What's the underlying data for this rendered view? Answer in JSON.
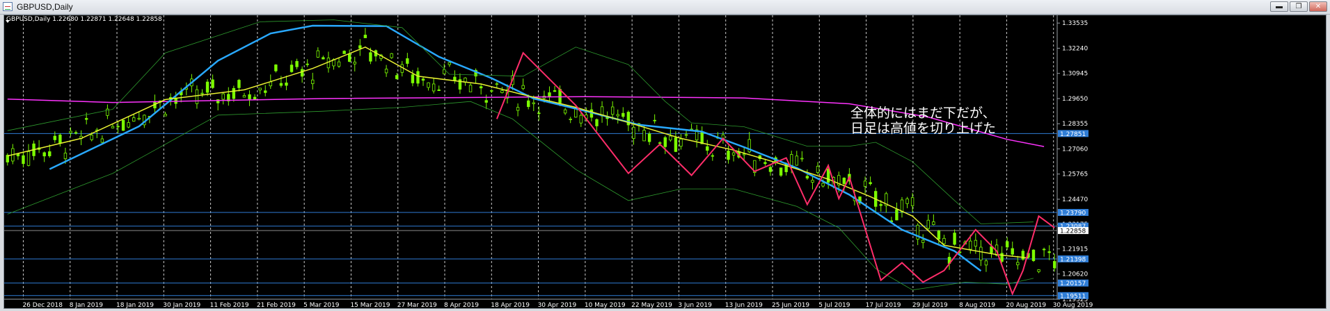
{
  "window": {
    "title": "GBPUSD,Daily",
    "buttons": [
      {
        "name": "minimize",
        "symbol": "▬"
      },
      {
        "name": "restore",
        "symbol": "❐"
      },
      {
        "name": "close",
        "symbol": "✕"
      }
    ]
  },
  "chart": {
    "symbol_header": "GBPUSD,Daily  1.22680 1.22871 1.22648 1.22858",
    "annotation_lines": [
      "全体的にはまだ下だが、",
      "日足は高値を切り上げた"
    ],
    "colors": {
      "background": "#000000",
      "candle": "#7cfc00",
      "ma_slow": "#ff33ff",
      "ma_mid": "#29a9ff",
      "ma_fast": "#e8f032",
      "bands": "#2e9b2e",
      "zigzag": "#ff2d6a",
      "hline": "#2f7dd6",
      "grid": "#ffffff"
    }
  },
  "chart_data": {
    "type": "candlestick",
    "symbol": "GBPUSD",
    "timeframe": "Daily",
    "ohlc_last": {
      "open": 1.2268,
      "high": 1.22871,
      "low": 1.22648,
      "close": 1.22858
    },
    "ylim": [
      1.19325,
      1.3365
    ],
    "y_ticks": [
      "1.33535",
      "1.32240",
      "1.30945",
      "1.29650",
      "1.28355",
      "1.27060",
      "1.25765",
      "1.24470",
      "1.23175",
      "1.21915",
      "1.20620",
      "1.19325"
    ],
    "x_ticks": [
      "26 Dec 2018",
      "8 Jan 2019",
      "18 Jan 2019",
      "30 Jan 2019",
      "11 Feb 2019",
      "21 Feb 2019",
      "5 Mar 2019",
      "15 Mar 2019",
      "27 Mar 2019",
      "8 Apr 2019",
      "18 Apr 2019",
      "30 Apr 2019",
      "10 May 2019",
      "22 May 2019",
      "3 Jun 2019",
      "13 Jun 2019",
      "25 Jun 2019",
      "5 Jul 2019",
      "17 Jul 2019",
      "29 Jul 2019",
      "8 Aug 2019",
      "20 Aug 2019",
      "30 Aug 2019"
    ],
    "price_lines": [
      {
        "label": "1.27851",
        "value": 1.27851
      },
      {
        "label": "1.23790",
        "value": 1.2379
      },
      {
        "label": "1.23087",
        "value": 1.23087
      },
      {
        "label": "1.22858",
        "value": 1.22858
      },
      {
        "label": "1.21398",
        "value": 1.21398
      },
      {
        "label": "1.20157",
        "value": 1.20157
      },
      {
        "label": "1.19511",
        "value": 1.19511
      }
    ],
    "series": [
      {
        "type": "line",
        "color_key": "ma_slow",
        "points": [
          [
            0,
            1.2962
          ],
          [
            20,
            1.2945
          ],
          [
            60,
            1.2965
          ],
          [
            110,
            1.2975
          ],
          [
            140,
            1.2968
          ],
          [
            160,
            1.2938
          ],
          [
            175,
            1.287
          ],
          [
            190,
            1.2755
          ],
          [
            197,
            1.2718
          ]
        ]
      },
      {
        "type": "line",
        "color_key": "ma_mid",
        "points": [
          [
            8,
            1.2602
          ],
          [
            25,
            1.2822
          ],
          [
            40,
            1.316
          ],
          [
            50,
            1.33
          ],
          [
            58,
            1.334
          ],
          [
            72,
            1.3338
          ],
          [
            82,
            1.318
          ],
          [
            92,
            1.307
          ],
          [
            100,
            1.2965
          ],
          [
            110,
            1.29
          ],
          [
            120,
            1.283
          ],
          [
            132,
            1.2795
          ],
          [
            140,
            1.2715
          ],
          [
            150,
            1.2608
          ],
          [
            160,
            1.247
          ],
          [
            170,
            1.229
          ],
          [
            180,
            1.218
          ],
          [
            185,
            1.2078
          ]
        ]
      },
      {
        "type": "line",
        "color_key": "ma_fast",
        "points": [
          [
            0,
            1.267
          ],
          [
            14,
            1.276
          ],
          [
            30,
            1.296
          ],
          [
            45,
            1.301
          ],
          [
            58,
            1.312
          ],
          [
            68,
            1.323
          ],
          [
            78,
            1.308
          ],
          [
            90,
            1.304
          ],
          [
            98,
            1.2985
          ],
          [
            108,
            1.292
          ],
          [
            117,
            1.285
          ],
          [
            128,
            1.276
          ],
          [
            138,
            1.27
          ],
          [
            148,
            1.262
          ],
          [
            156,
            1.255
          ],
          [
            164,
            1.246
          ],
          [
            172,
            1.236
          ],
          [
            178,
            1.221
          ],
          [
            188,
            1.2162
          ],
          [
            194,
            1.2145
          ]
        ]
      },
      {
        "type": "line",
        "color_key": "bands",
        "points": [
          [
            0,
            1.28
          ],
          [
            20,
            1.291
          ],
          [
            30,
            1.32
          ],
          [
            48,
            1.336
          ],
          [
            62,
            1.337
          ],
          [
            75,
            1.333
          ],
          [
            84,
            1.309
          ],
          [
            98,
            1.308
          ],
          [
            108,
            1.323
          ],
          [
            118,
            1.314
          ],
          [
            125,
            1.295
          ],
          [
            130,
            1.284
          ],
          [
            140,
            1.282
          ],
          [
            152,
            1.272
          ],
          [
            160,
            1.272
          ],
          [
            165,
            1.274
          ],
          [
            172,
            1.264
          ],
          [
            180,
            1.244
          ],
          [
            185,
            1.232
          ],
          [
            195,
            1.233
          ]
        ]
      },
      {
        "type": "line",
        "color_key": "bands",
        "points": [
          [
            0,
            1.237
          ],
          [
            20,
            1.258
          ],
          [
            28,
            1.27
          ],
          [
            40,
            1.288
          ],
          [
            60,
            1.29
          ],
          [
            75,
            1.292
          ],
          [
            88,
            1.295
          ],
          [
            96,
            1.286
          ],
          [
            108,
            1.26
          ],
          [
            118,
            1.244
          ],
          [
            128,
            1.25
          ],
          [
            138,
            1.25
          ],
          [
            150,
            1.241
          ],
          [
            158,
            1.23
          ],
          [
            165,
            1.209
          ],
          [
            172,
            1.198
          ],
          [
            182,
            1.202
          ],
          [
            190,
            1.201
          ],
          [
            195,
            1.204
          ]
        ]
      },
      {
        "type": "line",
        "color_key": "zigzag",
        "points": [
          [
            93,
            1.286
          ],
          [
            98,
            1.32
          ],
          [
            108,
            1.293
          ],
          [
            118,
            1.258
          ],
          [
            124,
            1.273
          ],
          [
            130,
            1.257
          ],
          [
            136,
            1.276
          ],
          [
            142,
            1.259
          ],
          [
            148,
            1.266
          ],
          [
            152,
            1.242
          ],
          [
            156,
            1.262
          ],
          [
            158,
            1.245
          ],
          [
            160,
            1.256
          ],
          [
            166,
            1.203
          ],
          [
            170,
            1.212
          ],
          [
            174,
            1.202
          ],
          [
            178,
            1.208
          ],
          [
            184,
            1.229
          ],
          [
            188,
            1.218
          ],
          [
            191,
            1.196
          ],
          [
            193,
            1.208
          ],
          [
            196,
            1.236
          ],
          [
            199,
            1.23
          ]
        ]
      }
    ]
  }
}
